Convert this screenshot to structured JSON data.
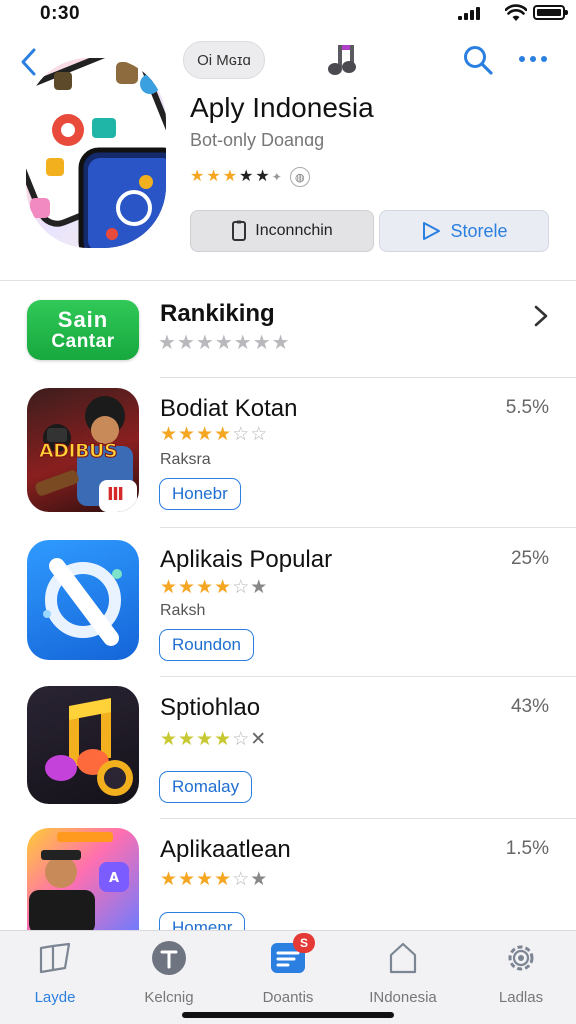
{
  "status_bar": {
    "time": "0:30"
  },
  "nav": {
    "pill_label": "Oi Mɢɪɑ"
  },
  "hero": {
    "title": "Aply Indonesia",
    "subtitle": "Bot-only Doanɑg",
    "rating": 3.5,
    "install_label": "Inconnchin",
    "store_label": "Storele"
  },
  "ranking": {
    "badge_line1": "Sain",
    "badge_line2": "Cantar",
    "title": "Rankiking",
    "rating": 0
  },
  "apps": [
    {
      "name": "Bodiat Kotan",
      "percent": "5.5%",
      "rating": 4,
      "category": "Raksra",
      "button": "Honebr",
      "icon_text": "ADIBUS"
    },
    {
      "name": "Aplikais Popular",
      "percent": "25%",
      "rating": 4,
      "category": "Raksh",
      "button": "Roundon"
    },
    {
      "name": "Sptiohlao",
      "percent": "43%",
      "rating": 4,
      "category": "",
      "button": "Romalay"
    },
    {
      "name": "Aplikaatlean",
      "percent": "1.5%",
      "rating": 4,
      "category": "",
      "button": "Homenr"
    }
  ],
  "tabbar": {
    "items": [
      {
        "label": "Layde",
        "active": true
      },
      {
        "label": "Kelcnig",
        "active": false
      },
      {
        "label": "Doantis",
        "active": false,
        "badge": "S"
      },
      {
        "label": "INdonesia",
        "active": false
      },
      {
        "label": "Ladlas",
        "active": false
      }
    ]
  },
  "colors": {
    "accent": "#2b7fe0",
    "star_gold": "#f5a623",
    "star_empty": "#b8b8bd",
    "ranking_badge": "#22b84a",
    "tab_badge": "#e53935"
  }
}
